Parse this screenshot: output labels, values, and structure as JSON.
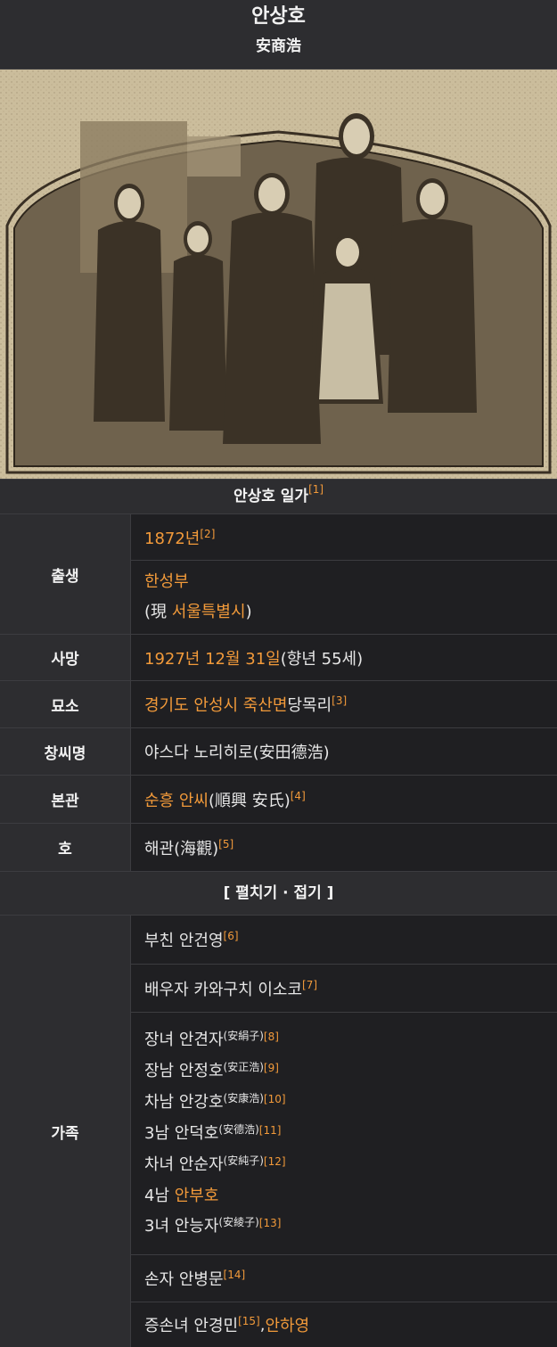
{
  "header": {
    "title": "안상호",
    "subtitle": "安商浩"
  },
  "photo": {
    "alt": "안상호 일가 사진"
  },
  "caption": {
    "text": "안상호 일가",
    "ref": "[1]"
  },
  "birth": {
    "label": "출생",
    "year": "1872년",
    "year_ref": "[2]",
    "place": "한성부",
    "place_prefix": "(現 ",
    "place_modern": "서울특별시",
    "place_suffix": ")"
  },
  "death": {
    "label": "사망",
    "date": "1927년 12월 31일",
    "age": " (향년 55세)"
  },
  "grave": {
    "label": "묘소",
    "place_link": "경기도 안성시 죽산면",
    "place_rest": " 당목리",
    "ref": "[3]"
  },
  "soshi": {
    "label": "창씨명",
    "value": "야스다 노리히로(安田德浩)"
  },
  "bongwan": {
    "label": "본관",
    "link": "순흥 안씨",
    "hanja": " (順興 安氏)",
    "ref": "[4]"
  },
  "ho": {
    "label": "호",
    "value": "해관(海觀)",
    "ref": "[5]"
  },
  "toggle": {
    "label": "[ 펼치기 · 접기 ]"
  },
  "family": {
    "label": "가족",
    "father": {
      "text": "부친 안건영",
      "ref": "[6]"
    },
    "spouse": {
      "text": "배우자 카와구치 이소코",
      "ref": "[7]"
    },
    "children": [
      {
        "text": "장녀 안견자",
        "hanja": "(安絹子)",
        "ref": "[8]"
      },
      {
        "text": "장남 안정호",
        "hanja": "(安正浩)",
        "ref": "[9]"
      },
      {
        "text": "차남 안강호",
        "hanja": "(安康浩)",
        "ref": "[10]"
      },
      {
        "text": "3남 안덕호",
        "hanja": "(安德浩)",
        "ref": "[11]"
      },
      {
        "text": "차녀 안순자",
        "hanja": "(安純子)",
        "ref": "[12]"
      },
      {
        "prefix": "4남 ",
        "link": "안부호"
      },
      {
        "text": "3녀 안능자",
        "hanja": "(安綾子)",
        "ref": "[13]"
      }
    ],
    "grandson": {
      "text": "손자 안병문",
      "ref": "[14]"
    },
    "great_granddaughter": {
      "text": "증손녀 안경민",
      "ref": "[15]",
      "sep": ", ",
      "link": "안하영"
    }
  },
  "colors": {
    "accent": "#f29a3a",
    "header_bg": "#2d2d30",
    "cell_bg": "#1f1f22"
  }
}
